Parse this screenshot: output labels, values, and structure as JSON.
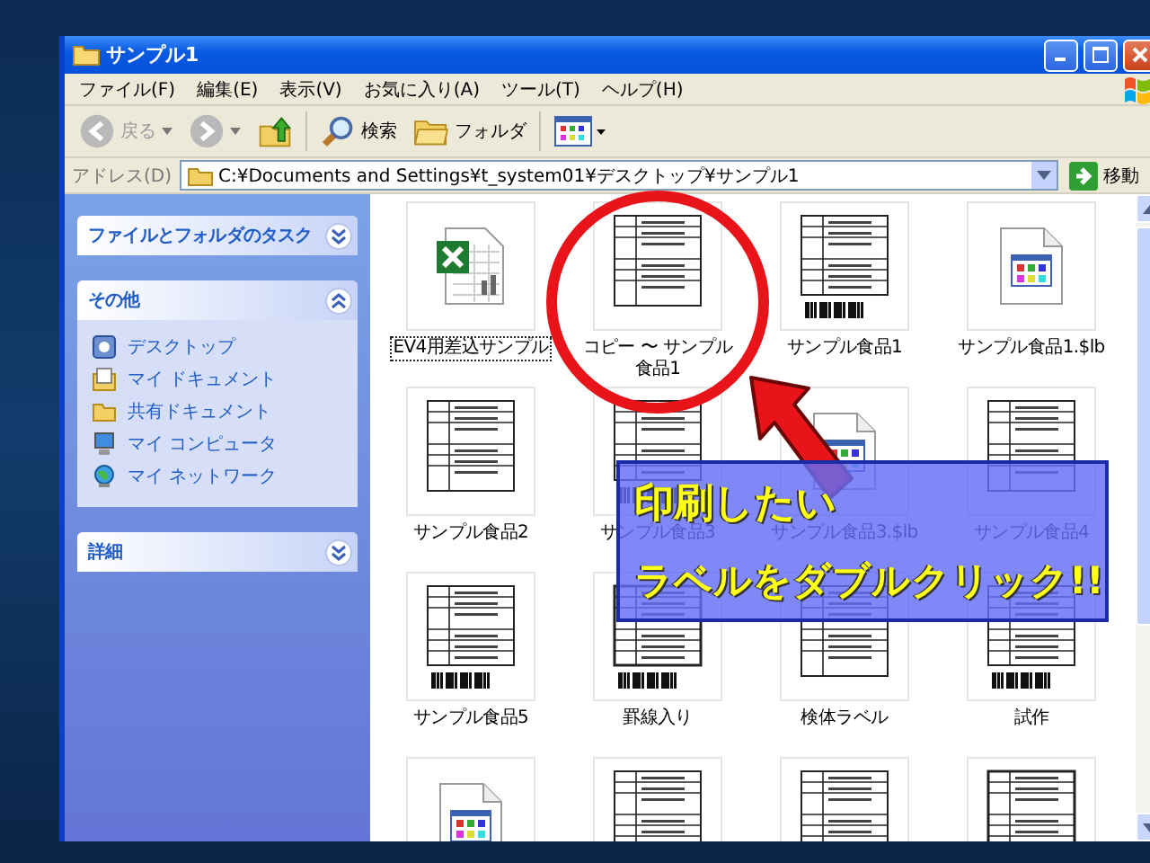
{
  "window": {
    "title": "サンプル1"
  },
  "menu": [
    "ファイル(F)",
    "編集(E)",
    "表示(V)",
    "お気に入り(A)",
    "ツール(T)",
    "ヘルプ(H)"
  ],
  "toolbar": [
    {
      "kind": "back",
      "label": "戻る",
      "disabled": true
    },
    {
      "kind": "forward",
      "disabled": true
    },
    {
      "kind": "up",
      "disabled": false
    },
    {
      "kind": "search",
      "label": "検索",
      "disabled": false
    },
    {
      "kind": "folders",
      "label": "フォルダ",
      "disabled": false
    },
    {
      "kind": "views",
      "disabled": false
    }
  ],
  "address": {
    "label": "アドレス(D)",
    "path": "C:¥Documents and Settings¥t_system01¥デスクトップ¥サンプル1",
    "go": "移動"
  },
  "sidebar": [
    {
      "title": "ファイルとフォルダのタスク",
      "expanded": false
    },
    {
      "title": "その他",
      "expanded": true,
      "items": [
        {
          "kind": "desktop",
          "label": "デスクトップ"
        },
        {
          "kind": "documents",
          "label": "マイ ドキュメント"
        },
        {
          "kind": "folder",
          "label": "共有ドキュメント"
        },
        {
          "kind": "computer",
          "label": "マイ コンピュータ"
        },
        {
          "kind": "network",
          "label": "マイ ネットワーク"
        }
      ]
    },
    {
      "title": "詳細",
      "expanded": false
    }
  ],
  "files": [
    {
      "name": "EV4用差込サンプル",
      "kind": "spreadsheet",
      "focused": true,
      "circled": false
    },
    {
      "name": "コピー 〜 サンプル食品1",
      "kind": "label",
      "focused": false,
      "circled": true
    },
    {
      "name": "サンプル食品1",
      "kind": "label",
      "focused": false,
      "circled": false
    },
    {
      "name": "サンプル食品1.$lb",
      "kind": "document",
      "focused": false,
      "circled": false
    },
    {
      "name": "サンプル食品2",
      "kind": "label",
      "focused": false,
      "circled": false
    },
    {
      "name": "サンプル食品3",
      "kind": "label",
      "focused": false,
      "circled": false
    },
    {
      "name": "サンプル食品3.$lb",
      "kind": "document",
      "focused": false,
      "circled": false
    },
    {
      "name": "サンプル食品4",
      "kind": "label",
      "focused": false,
      "circled": false
    },
    {
      "name": "サンプル食品5",
      "kind": "label",
      "focused": false,
      "circled": false
    },
    {
      "name": "罫線入り",
      "kind": "label",
      "focused": false,
      "circled": false
    },
    {
      "name": "検体ラベル",
      "kind": "label",
      "focused": false,
      "circled": false
    },
    {
      "name": "試作",
      "kind": "label",
      "focused": false,
      "circled": false
    },
    {
      "kind": "document",
      "focused": false,
      "circled": false
    },
    {
      "kind": "label",
      "focused": false,
      "circled": false
    },
    {
      "kind": "label",
      "focused": false,
      "circled": false
    },
    {
      "kind": "label",
      "focused": false,
      "circled": false
    }
  ],
  "callout": {
    "lines": [
      "印刷したい",
      "ラベルをダブルクリック!!"
    ]
  }
}
